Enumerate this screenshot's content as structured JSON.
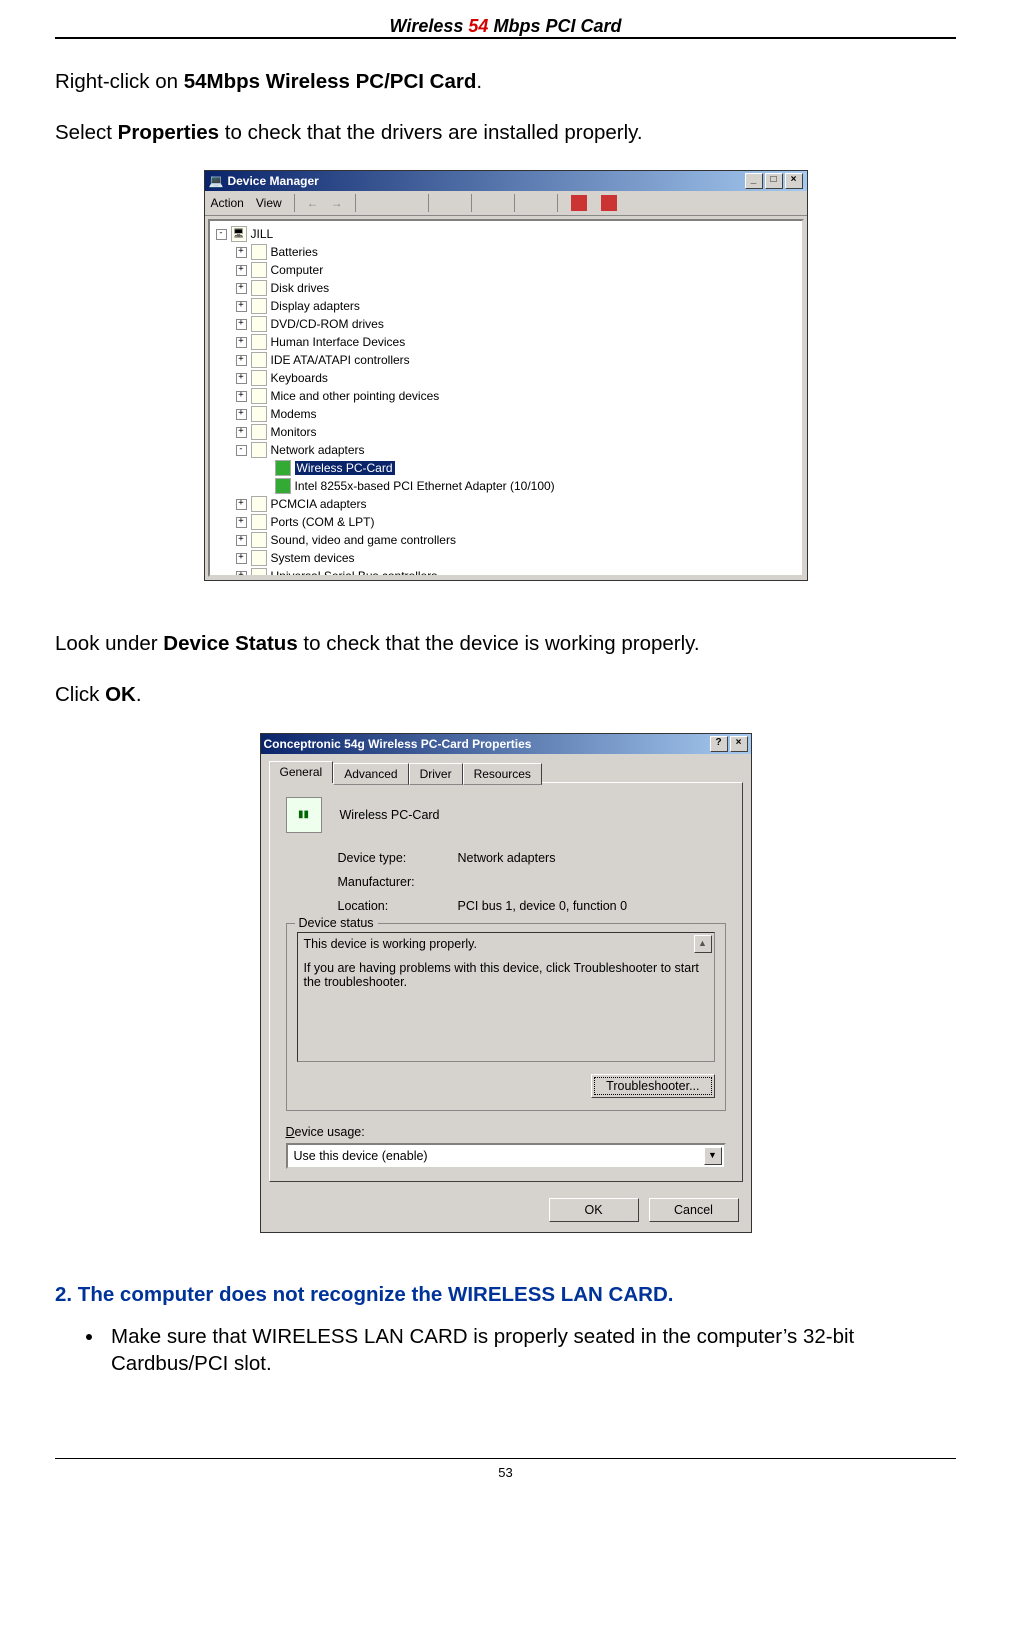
{
  "header": {
    "prefix": "Wireless ",
    "highlight": "54",
    "suffix": " Mbps PCI Card"
  },
  "body": {
    "p1_a": "Right-click on ",
    "p1_b": "54Mbps Wireless PC/PCI Card",
    "p1_c": ".",
    "p2_a": "Select ",
    "p2_b": "Properties",
    "p2_c": " to check that the drivers are installed properly.",
    "p3_a": "Look under ",
    "p3_b": "Device Status",
    "p3_c": " to check that the device is working properly.",
    "p4_a": "Click ",
    "p4_b": "OK",
    "p4_c": "."
  },
  "device_manager": {
    "title": "Device Manager",
    "menu": {
      "action": "Action",
      "view": "View"
    },
    "root": "JILL",
    "items": [
      "Batteries",
      "Computer",
      "Disk drives",
      "Display adapters",
      "DVD/CD-ROM drives",
      "Human Interface Devices",
      "IDE ATA/ATAPI controllers",
      "Keyboards",
      "Mice and other pointing devices",
      "Modems",
      "Monitors",
      "Network adapters",
      "PCMCIA adapters",
      "Ports (COM & LPT)",
      "Sound, video and game controllers",
      "System devices",
      "Universal Serial Bus controllers"
    ],
    "network_children": {
      "selected": "Wireless PC-Card",
      "other": "Intel 8255x-based PCI Ethernet Adapter (10/100)"
    }
  },
  "properties": {
    "title": "Conceptronic 54g Wireless PC-Card Properties",
    "tabs": [
      "General",
      "Advanced",
      "Driver",
      "Resources"
    ],
    "device_name": "Wireless PC-Card",
    "rows": {
      "type_k": "Device type:",
      "type_v": "Network adapters",
      "manu_k": "Manufacturer:",
      "manu_v": " ",
      "loc_k": "Location:",
      "loc_v": "PCI bus 1, device 0, function 0"
    },
    "status_legend": "Device status",
    "status_line1": "This device is working properly.",
    "status_line2": "If you are having problems with this device, click Troubleshooter to start the troubleshooter.",
    "troubleshoot_btn": "Troubleshooter...",
    "usage_label": "Device usage:",
    "usage_value": "Use this device (enable)",
    "ok": "OK",
    "cancel": "Cancel"
  },
  "section2": {
    "heading": "2. The computer does not recognize the WIRELESS LAN CARD.",
    "bullet1": "Make sure that WIRELESS LAN CARD is properly seated in the computer’s 32-bit Cardbus/PCI slot."
  },
  "footer": {
    "page": "53"
  }
}
